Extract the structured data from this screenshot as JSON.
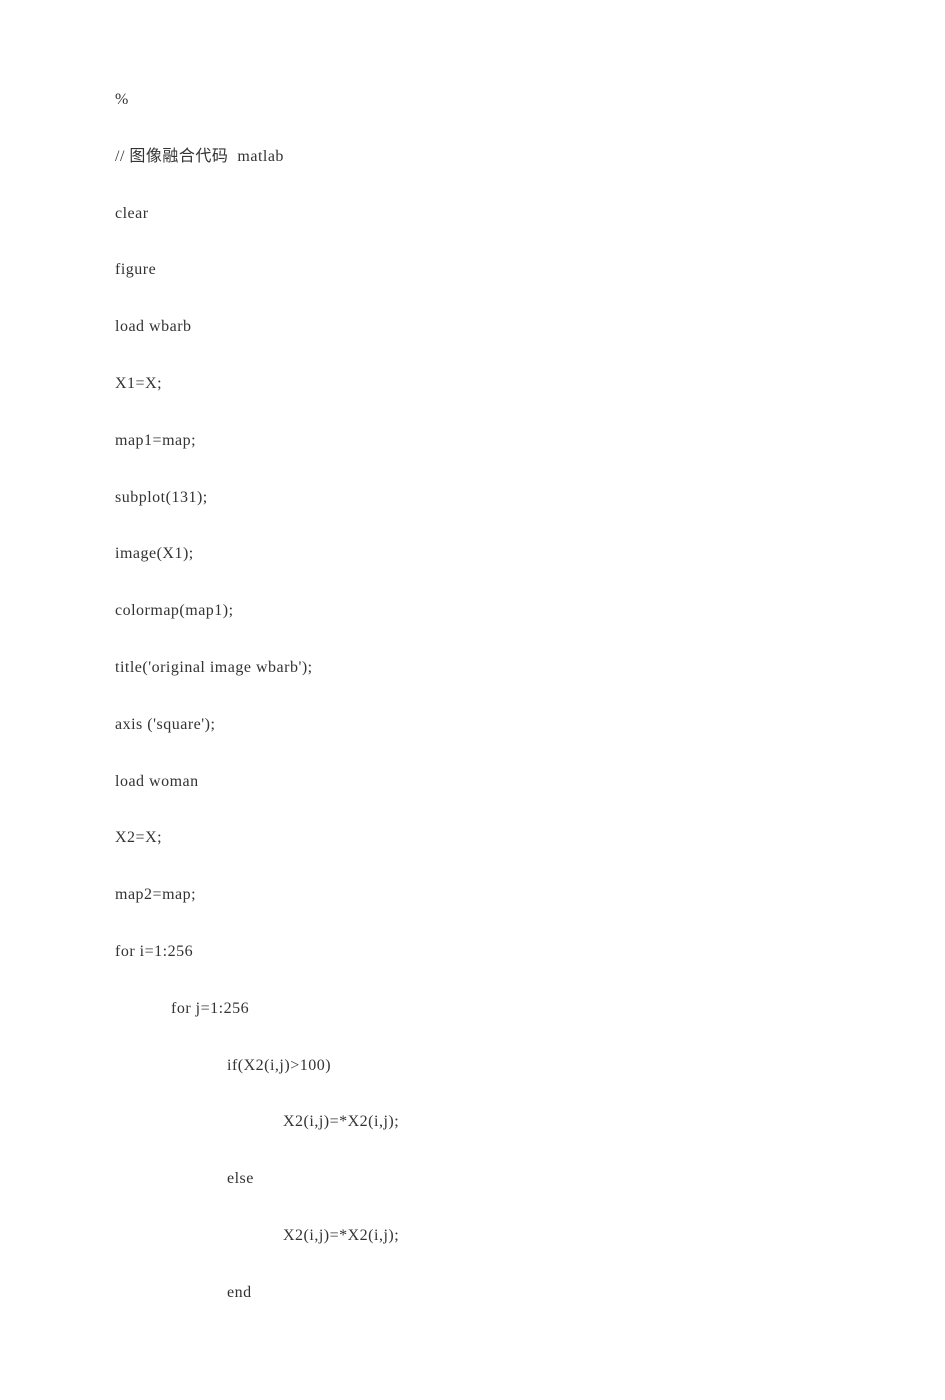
{
  "code": {
    "line1": "%",
    "line2": "// 图像融合代码  matlab",
    "line3": "clear",
    "line4": "figure",
    "line5": "load wbarb",
    "line6": "X1=X;",
    "line7": "map1=map;",
    "line8": "subplot(131);",
    "line9": "image(X1);",
    "line10": "colormap(map1);",
    "line11": "title('original image wbarb');",
    "line12": "axis ('square');",
    "line13": "load woman",
    "line14": "X2=X;",
    "line15": "map2=map;",
    "line16": "for i=1:256",
    "line17": "for j=1:256",
    "line18": "if(X2(i,j)>100)",
    "line19": "X2(i,j)=*X2(i,j);",
    "line20": "else",
    "line21": "X2(i,j)=*X2(i,j);",
    "line22": "end"
  }
}
